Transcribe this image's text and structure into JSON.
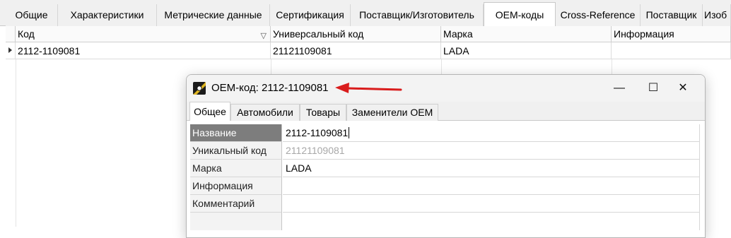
{
  "main_tabs": [
    {
      "label": "Общие"
    },
    {
      "label": "Характеристики"
    },
    {
      "label": "Метрические данные"
    },
    {
      "label": "Сертификация"
    },
    {
      "label": "Поставщик/Изготовитель"
    },
    {
      "label": "ОЕМ-коды"
    },
    {
      "label": "Cross-Reference"
    },
    {
      "label": "Поставщик"
    },
    {
      "label": "Изоб"
    }
  ],
  "grid": {
    "columns": [
      "Код",
      "Универсальный код",
      "Марка",
      "Информация"
    ],
    "rows": [
      {
        "code": "2112-1109081",
        "universal": "21121109081",
        "brand": "LADA",
        "info": ""
      }
    ]
  },
  "dialog": {
    "title": "ОЕМ-код: 2112-1109081",
    "controls": {
      "minimize": "—",
      "maximize": "☐",
      "close": "✕"
    },
    "tabs": [
      "Общее",
      "Автомобили",
      "Товары",
      "Заменители ОЕМ"
    ],
    "fields": [
      {
        "label": "Название",
        "value": "2112-1109081"
      },
      {
        "label": "Уникальный код",
        "value": "21121109081"
      },
      {
        "label": "Марка",
        "value": "LADA"
      },
      {
        "label": "Информация",
        "value": ""
      },
      {
        "label": "Комментарий",
        "value": ""
      }
    ]
  },
  "colors": {
    "annotation_arrow": "#d91c1c",
    "selected_label_bg": "#7d7d7d"
  }
}
